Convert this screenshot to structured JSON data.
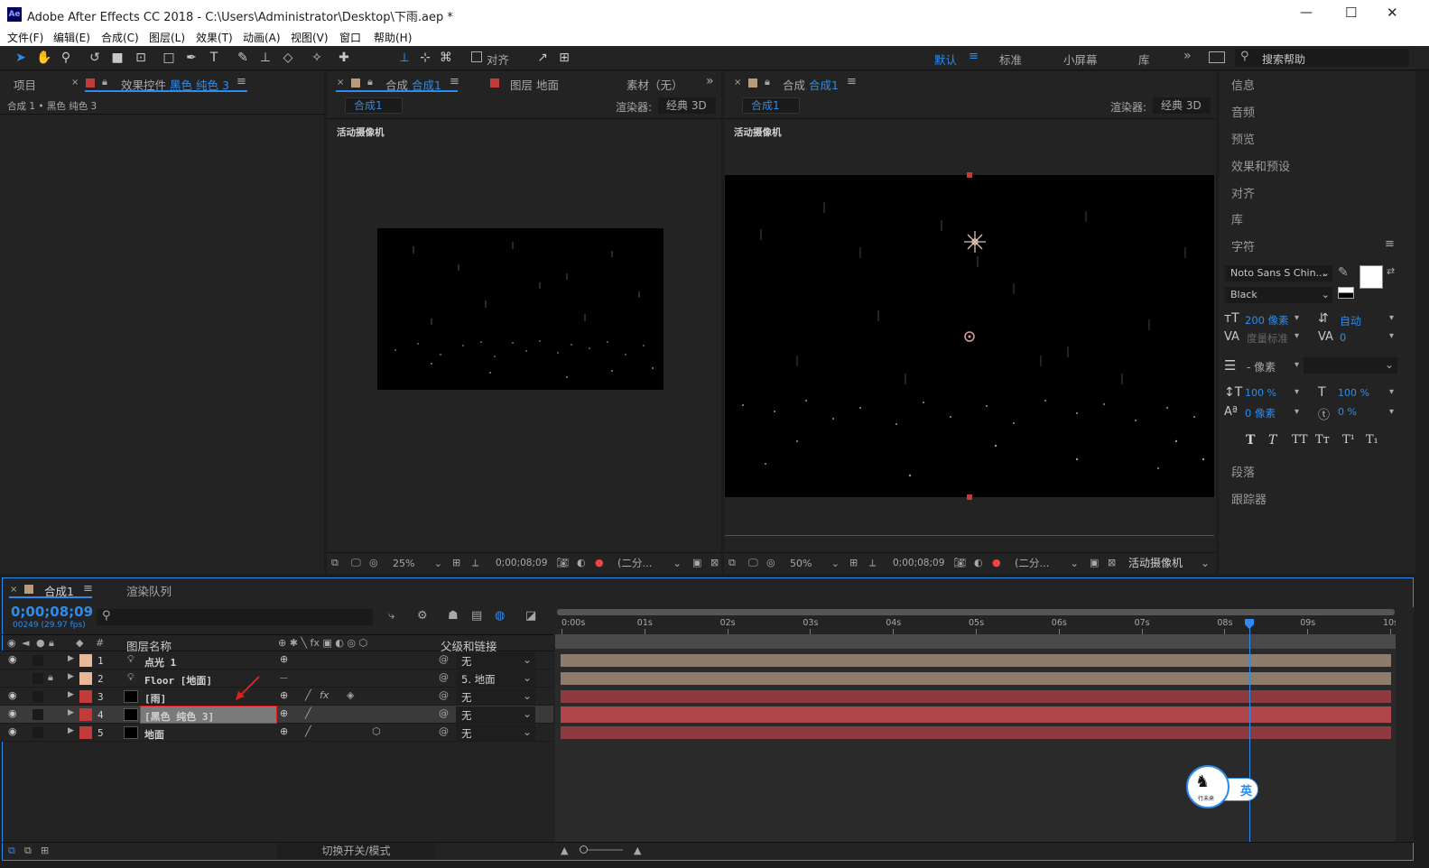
{
  "window": {
    "title": "Adobe After Effects CC 2018 - C:\\Users\\Administrator\\Desktop\\下雨.aep *",
    "app_icon": "Ae",
    "minimize": "—",
    "maximize": "☐",
    "close": "✕"
  },
  "menu": [
    "文件(F)",
    "编辑(E)",
    "合成(C)",
    "图层(L)",
    "效果(T)",
    "动画(A)",
    "视图(V)",
    "窗口",
    "帮助(H)"
  ],
  "toolbar": {
    "align_label": "对齐",
    "workspaces": [
      "默认",
      "标准",
      "小屏幕",
      "库"
    ],
    "search_placeholder": "搜索帮助"
  },
  "left_panel": {
    "tab_project": "项目",
    "tab_effects_prefix": "效果控件",
    "tab_effects_layer": "黑色 纯色 3",
    "breadcrumb": "合成 1 • 黑色 纯色 3"
  },
  "comp_panel_1": {
    "tab_prefix": "合成",
    "tab_comp": "合成1",
    "tab_layer": "图层 地面",
    "tab_footage": "素材（无）",
    "comp_chip": "合成1",
    "renderer_label": "渲染器:",
    "renderer_value": "经典 3D",
    "camera_label": "活动摄像机",
    "zoom": "25%",
    "timecode": "0;00;08;09",
    "resolution": "(二分..."
  },
  "comp_panel_2": {
    "tab_prefix": "合成",
    "tab_comp": "合成1",
    "comp_chip": "合成1",
    "renderer_label": "渲染器:",
    "renderer_value": "经典 3D",
    "camera_label": "活动摄像机",
    "zoom": "50%",
    "timecode": "0;00;08;09",
    "resolution": "(二分...",
    "view": "活动摄像机"
  },
  "right_panel": {
    "items": [
      "信息",
      "音频",
      "预览",
      "效果和预设",
      "对齐",
      "库"
    ],
    "character_title": "字符",
    "font": "Noto Sans S Chin...",
    "style": "Black",
    "font_size": "200 像素",
    "leading": "自动",
    "kerning": "度量标准",
    "tracking": "0",
    "stroke": "- 像素",
    "v_scale": "100 %",
    "h_scale": "100 %",
    "baseline": "0 像素",
    "tsume": "0 %",
    "style_buttons": [
      "T",
      "T",
      "TT",
      "Tт",
      "T¹",
      "T₁"
    ],
    "paragraph": "段落",
    "tracker": "跟踪器"
  },
  "timeline": {
    "tab_comp": "合成1",
    "tab_render": "渲染队列",
    "timecode": "0;00;08;09",
    "frame_info": "00249 (29.97 fps)",
    "col_layer_name": "图层名称",
    "col_parent": "父级和链接",
    "hash_label": "#",
    "toggle_label": "切换开关/模式",
    "ruler": [
      "0:00s",
      "01s",
      "02s",
      "03s",
      "04s",
      "05s",
      "06s",
      "07s",
      "08s",
      "09s",
      "10s"
    ],
    "playhead_seconds": 8.3,
    "layers": [
      {
        "num": "1",
        "name": "点光 1",
        "parent": "无",
        "color": "#e8b899",
        "track_color": "#8d7b6b"
      },
      {
        "num": "2",
        "name": "Floor [地面]",
        "parent": "5. 地面",
        "color": "#e8b899",
        "track_color": "#8d7b6b"
      },
      {
        "num": "3",
        "name": "[雨]",
        "parent": "无",
        "color": "#c33a3a",
        "track_color": "#8c3a3f"
      },
      {
        "num": "4",
        "name": "[黑色 纯色 3]",
        "parent": "无",
        "color": "#c33a3a",
        "track_color": "#b0454b"
      },
      {
        "num": "5",
        "name": "地面",
        "parent": "无",
        "color": "#c33a3a",
        "track_color": "#8c3a3f"
      }
    ]
  },
  "ime_badge": {
    "logo_text": "行未来",
    "lang": "英"
  }
}
